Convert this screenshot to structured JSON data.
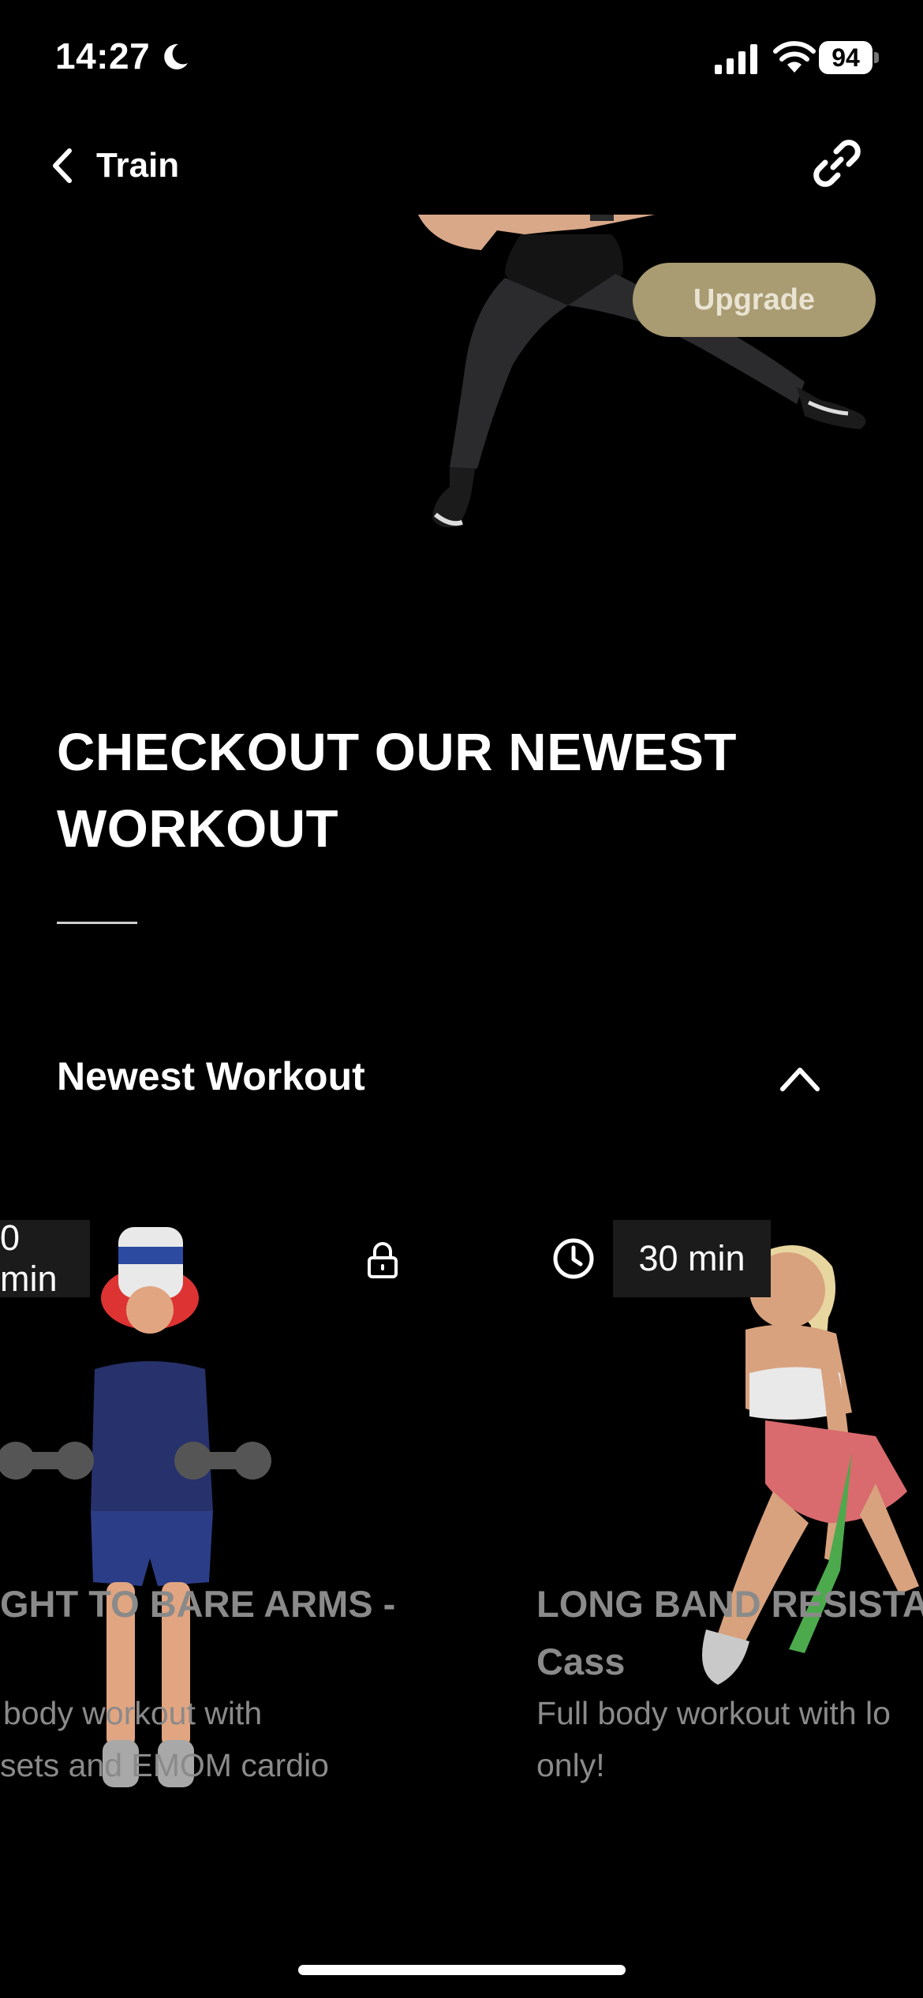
{
  "status": {
    "time": "14:27",
    "battery": "94"
  },
  "nav": {
    "back_label": "Train"
  },
  "hero": {
    "upgrade_label": "Upgrade"
  },
  "heading": {
    "line1": "CHECKOUT OUR NEWEST",
    "line2": "WORKOUT"
  },
  "section": {
    "title": "Newest Workout"
  },
  "cards": [
    {
      "duration": "0 min",
      "title_line1": "GHT TO BARE ARMS -",
      "desc_line1": "body workout with",
      "desc_line2": "sets and EMOM cardio",
      "locked": true
    },
    {
      "duration": "30 min",
      "title_line1": "LONG BAND RESISTA",
      "title_line2": "Cass",
      "desc_line1": "Full body workout with lo",
      "desc_line2": "only!"
    }
  ],
  "colors": {
    "background": "#000000",
    "upgrade": "#a99b72",
    "duration_bg": "#1b1b1b",
    "muted_text": "#8a8a8a"
  }
}
